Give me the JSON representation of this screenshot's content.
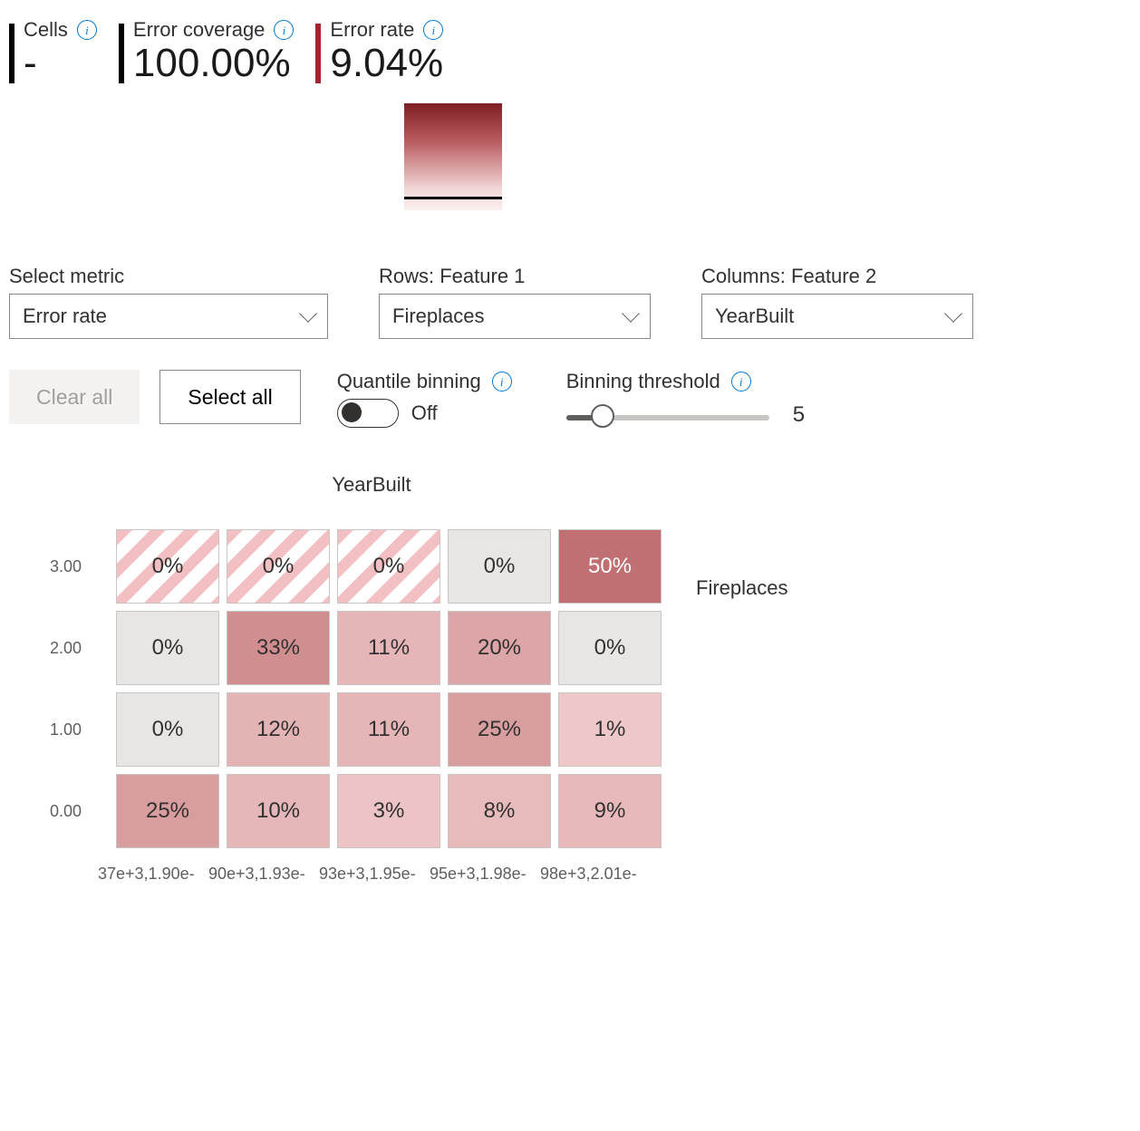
{
  "stats": {
    "cells": {
      "label": "Cells",
      "value": "-"
    },
    "coverage": {
      "label": "Error coverage",
      "value": "100.00%"
    },
    "rate": {
      "label": "Error rate",
      "value": "9.04%"
    }
  },
  "dropdowns": {
    "metric": {
      "label": "Select metric",
      "value": "Error rate"
    },
    "rows": {
      "label": "Rows: Feature 1",
      "value": "Fireplaces"
    },
    "columns": {
      "label": "Columns: Feature 2",
      "value": "YearBuilt"
    }
  },
  "buttons": {
    "clear": "Clear all",
    "select": "Select all"
  },
  "toggle": {
    "label": "Quantile binning",
    "state": "Off"
  },
  "slider": {
    "label": "Binning threshold",
    "value": "5"
  },
  "heatmap": {
    "col_axis_title": "YearBuilt",
    "row_axis_title": "Fireplaces",
    "row_ticks": [
      "3.00",
      "2.00",
      "1.00",
      "0.00"
    ],
    "col_ticks": [
      "37e+3,1.90e-",
      "90e+3,1.93e-",
      "93e+3,1.95e-",
      "95e+3,1.98e-",
      "98e+3,2.01e-"
    ]
  },
  "chart_data": {
    "type": "heatmap",
    "metric": "Error rate",
    "row_feature": "Fireplaces",
    "column_feature": "YearBuilt",
    "row_categories": [
      "3.00",
      "2.00",
      "1.00",
      "0.00"
    ],
    "column_categories": [
      "37e+3,1.90e-",
      "90e+3,1.93e-",
      "93e+3,1.95e-",
      "95e+3,1.98e-",
      "98e+3,2.01e-"
    ],
    "cells": [
      [
        {
          "display": "0%",
          "value": 0,
          "empty": true
        },
        {
          "display": "0%",
          "value": 0,
          "empty": true
        },
        {
          "display": "0%",
          "value": 0,
          "empty": true
        },
        {
          "display": "0%",
          "value": 0,
          "empty": false
        },
        {
          "display": "50%",
          "value": 50,
          "empty": false
        }
      ],
      [
        {
          "display": "0%",
          "value": 0,
          "empty": false
        },
        {
          "display": "33%",
          "value": 33,
          "empty": false
        },
        {
          "display": "11%",
          "value": 11,
          "empty": false
        },
        {
          "display": "20%",
          "value": 20,
          "empty": false
        },
        {
          "display": "0%",
          "value": 0,
          "empty": false
        }
      ],
      [
        {
          "display": "0%",
          "value": 0,
          "empty": false
        },
        {
          "display": "12%",
          "value": 12,
          "empty": false
        },
        {
          "display": "11%",
          "value": 11,
          "empty": false
        },
        {
          "display": "25%",
          "value": 25,
          "empty": false
        },
        {
          "display": "1%",
          "value": 1,
          "empty": false
        }
      ],
      [
        {
          "display": "25%",
          "value": 25,
          "empty": false
        },
        {
          "display": "10%",
          "value": 10,
          "empty": false
        },
        {
          "display": "3%",
          "value": 3,
          "empty": false
        },
        {
          "display": "8%",
          "value": 8,
          "empty": false
        },
        {
          "display": "9%",
          "value": 9,
          "empty": false
        }
      ]
    ],
    "colorscale": {
      "min_color": "#e8e6e4",
      "max_color": "#7d1f24"
    }
  }
}
